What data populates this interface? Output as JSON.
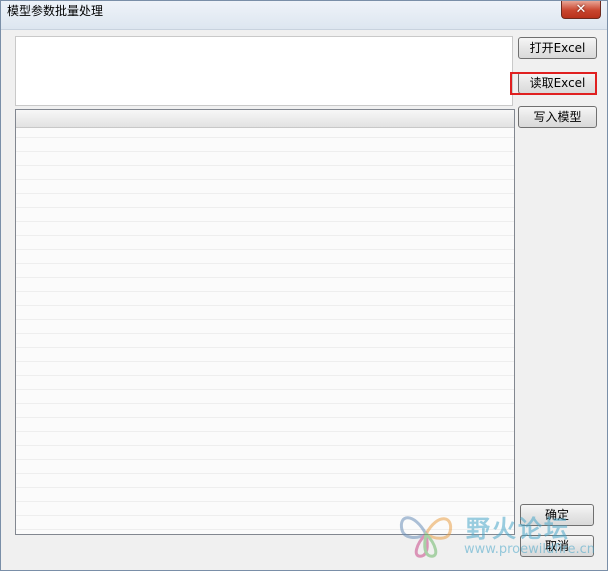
{
  "window": {
    "title": "模型参数批量处理",
    "close_symbol": "✕"
  },
  "buttons": {
    "open_excel": "打开Excel",
    "read_excel": "读取Excel",
    "write_model": "写入模型",
    "ok": "确定",
    "cancel": "取消"
  },
  "watermark": {
    "title": "野火论坛",
    "url": "www.proewildfire.cn"
  },
  "colors": {
    "highlight": "#e02020",
    "watermark": "#4aa7c9"
  }
}
